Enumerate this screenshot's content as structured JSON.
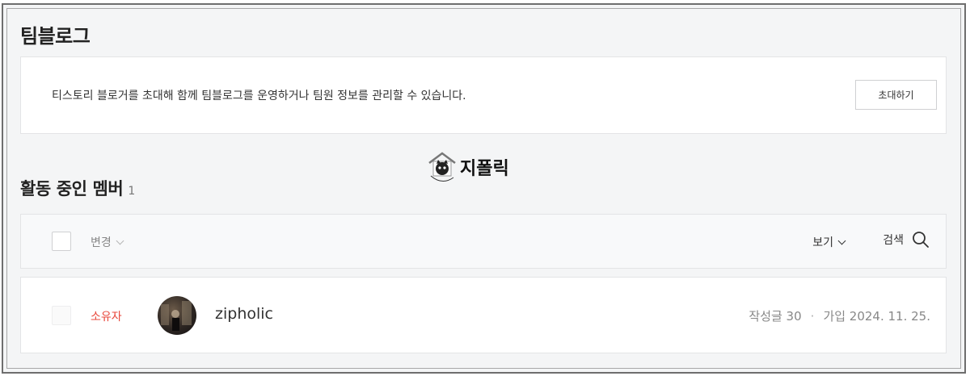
{
  "page": {
    "title": "팀블로그"
  },
  "invite": {
    "description": "티스토리 블로거를 초대해 함께 팀블로그를 운영하거나 팀원 정보를 관리할 수 있습니다.",
    "button_label": "초대하기"
  },
  "watermark": {
    "text": "지폴릭",
    "logo_caption": "Zipholic"
  },
  "members": {
    "title": "활동 중인 멤버",
    "count": "1",
    "toolbar": {
      "change_label": "변경",
      "view_label": "보기",
      "search_label": "검색"
    },
    "rows": [
      {
        "role": "소유자",
        "name": "zipholic",
        "posts": "작성글 30",
        "separator": "·",
        "joined": "가입 2024. 11. 25."
      }
    ]
  },
  "colors": {
    "owner_role": "#e8483c",
    "background": "#f4f5f6"
  }
}
